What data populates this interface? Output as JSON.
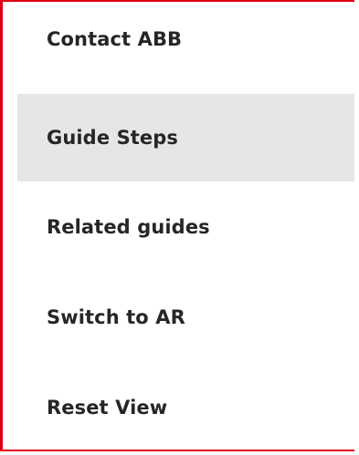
{
  "menu": {
    "items": [
      {
        "label": "Contact ABB"
      },
      {
        "label": "Guide Steps"
      },
      {
        "label": "Related guides"
      },
      {
        "label": "Switch to AR"
      },
      {
        "label": "Reset View"
      }
    ],
    "active_index": 1,
    "colors": {
      "border": "#e00016",
      "active_background": "#e6e6e6",
      "text": "#262626"
    }
  }
}
